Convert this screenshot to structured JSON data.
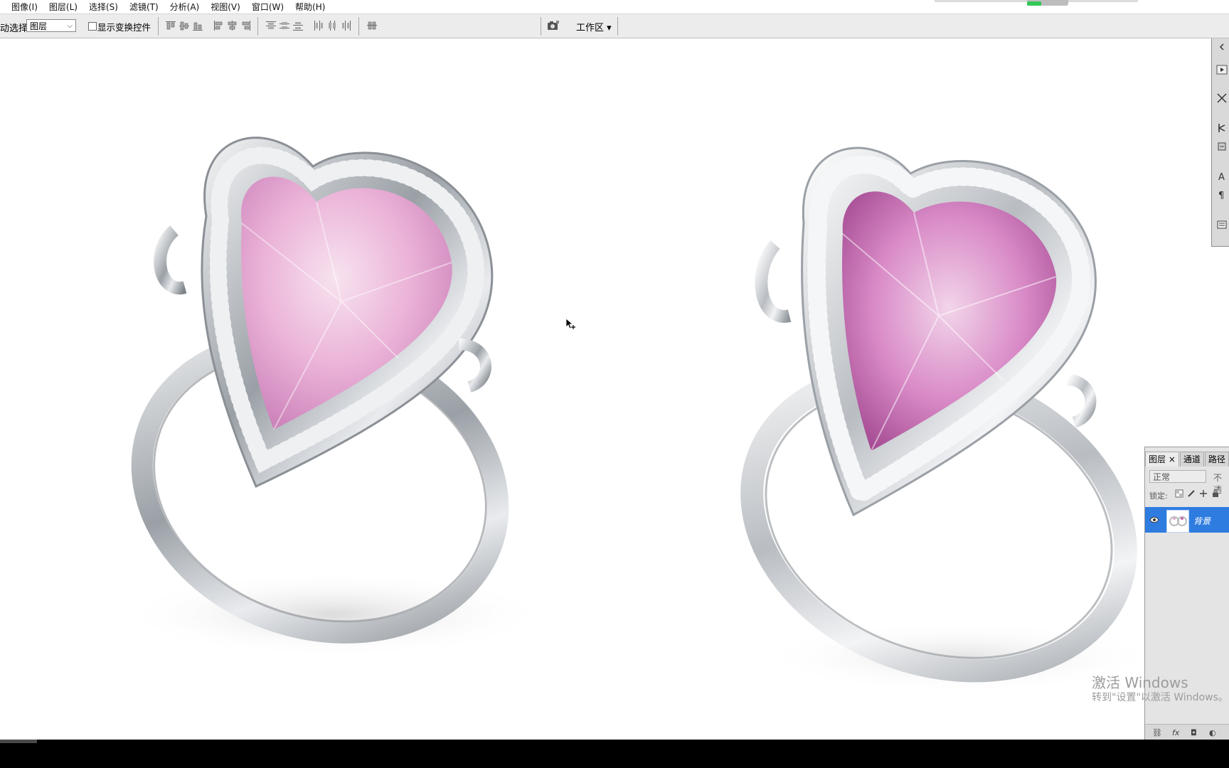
{
  "menubar": {
    "items": [
      "图像(I)",
      "图层(L)",
      "选择(S)",
      "滤镜(T)",
      "分析(A)",
      "视图(V)",
      "窗口(W)",
      "帮助(H)"
    ]
  },
  "options": {
    "auto_select_label": "动选择:",
    "auto_select_value": "图层",
    "show_transform_label": "显示变换控件",
    "workspace_label": "工作区 ▾"
  },
  "layers_panel": {
    "tabs": [
      "图层 ×",
      "通道",
      "路径"
    ],
    "blend_mode": "正常",
    "opacity_label": "不透",
    "lock_label": "锁定:",
    "layer_name": "背景",
    "footer_icons": [
      "link-icon",
      "fx-icon",
      "mask-icon",
      "adjustment-icon"
    ]
  },
  "watermark": {
    "line1": "激活 Windows",
    "line2": "转到\"设置\"以激活 Windows。"
  },
  "colors": {
    "layer_selected": "#2f7ce0",
    "gem_pink": "#e7a8d4",
    "gem_magenta": "#c05aa8",
    "metal": "#c9ccd0"
  }
}
